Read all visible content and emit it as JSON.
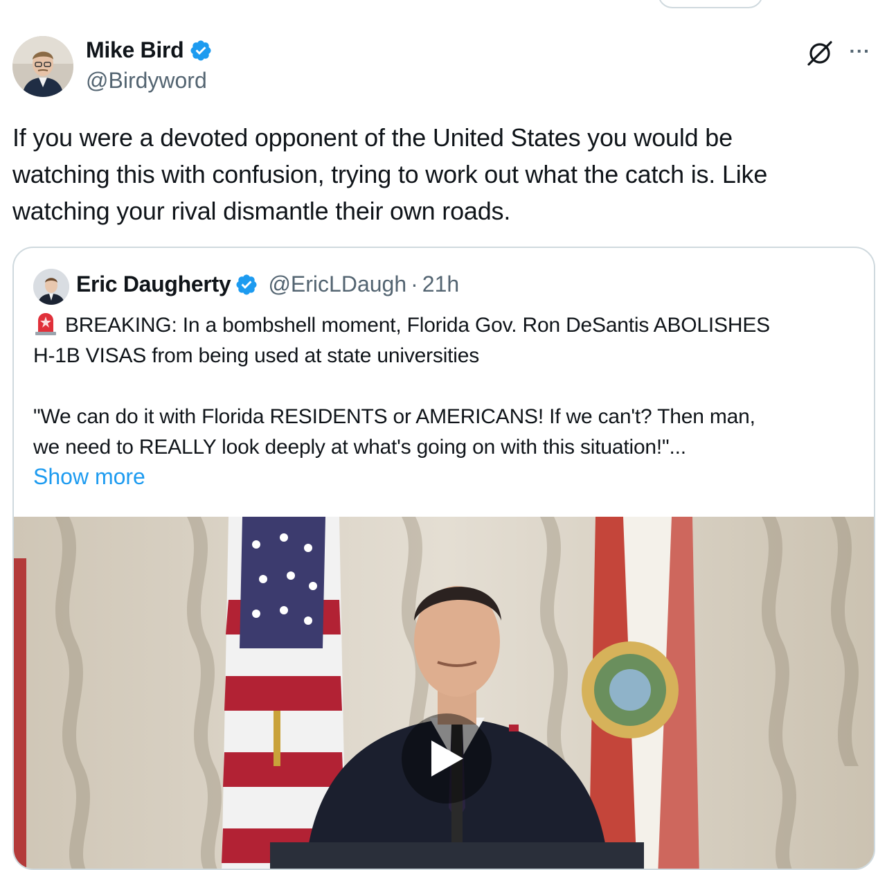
{
  "tweet": {
    "author_name": "Mike Bird",
    "author_handle": "@Birdyword",
    "text": "If you were a devoted opponent of the United States you would be\nwatching this with confusion, trying to work out what the catch is. Like\nwatching your rival dismantle their own roads."
  },
  "quote": {
    "author_name": "Eric Daugherty",
    "author_handle": "@EricLDaugh",
    "separator": "·",
    "time": "21h",
    "lines": [
      "BREAKING: In a bombshell moment, Florida Gov. Ron DeSantis ABOLISHES",
      "H-1B VISAS from being used at state universities",
      "\"We can do it with Florida RESIDENTS or AMERICANS! If we can't? Then man,",
      "we need to REALLY look deeply at what's going on with this situation!\"..."
    ],
    "show_more": "Show more"
  },
  "colors": {
    "accent": "#1d9bf0",
    "secondary_text": "#536471",
    "border": "#cfd9de",
    "verified": "#1d9bf0"
  },
  "icons": {
    "verified": "verified-badge-icon",
    "grok": "grok-icon",
    "more": "more-options-icon",
    "siren": "rotating-light-icon",
    "play": "play-icon"
  }
}
